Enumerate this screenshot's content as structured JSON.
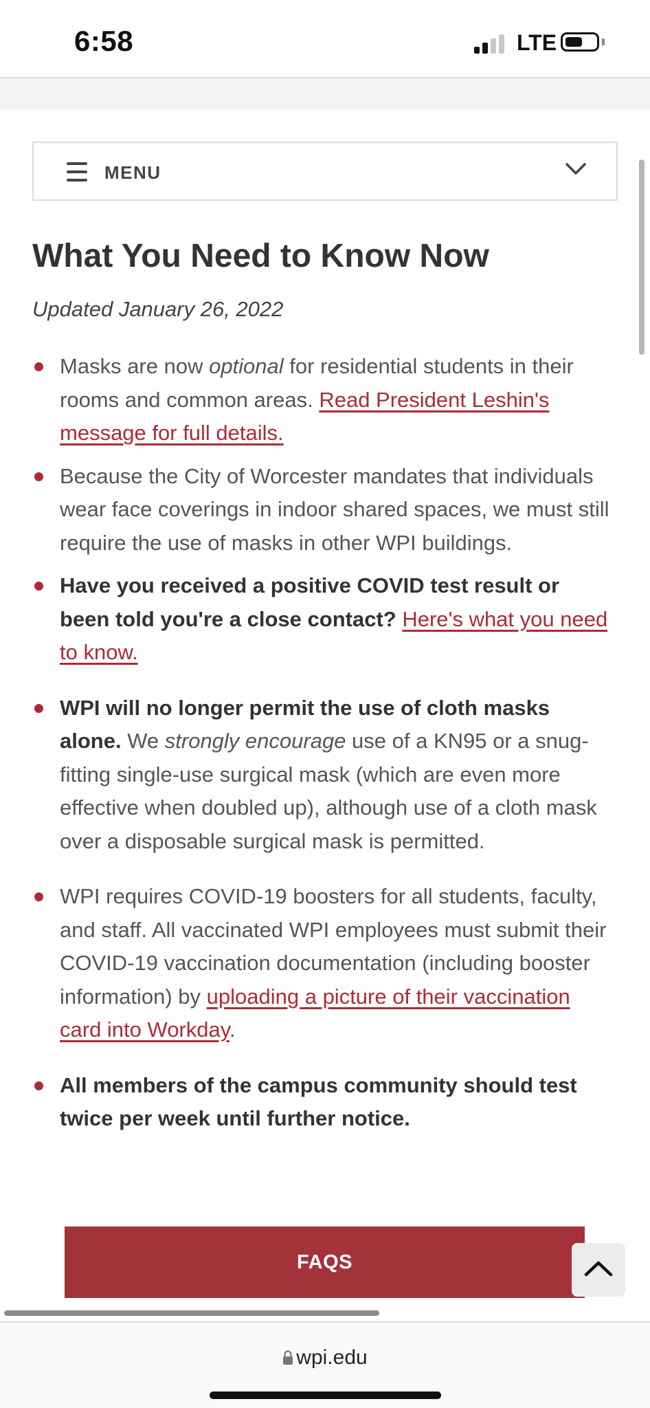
{
  "status_bar": {
    "time": "6:58",
    "network": "LTE",
    "signal_bars_filled": 2,
    "signal_bars_total": 4
  },
  "menu": {
    "label": "MENU",
    "hamburger_icon": "hamburger-icon",
    "expand_icon": "chevron-down-icon"
  },
  "page": {
    "title": "What You Need to Know Now",
    "updated": "Updated January 26, 2022"
  },
  "bullets": [
    {
      "t1": "Masks are now ",
      "em": "optional",
      "t2": " for residential students in their rooms and common areas. ",
      "link": "Read President Leshin's message for full details."
    },
    {
      "text": "Because the City of Worcester mandates that individuals wear face coverings in indoor shared spaces, we must still require the use of masks in other WPI buildings."
    },
    {
      "bold": "Have you received a positive COVID test result or been told you're a close contact?",
      "link": "Here's what you need to know."
    },
    {
      "bold": "WPI will no longer permit the use of cloth masks alone.",
      "t1": " We ",
      "em": "strongly encourage",
      "t2": " use of a KN95 or a snug-fitting single-use surgical mask (which are even more effective when doubled up), although use of a cloth mask over a disposable surgical mask is permitted."
    },
    {
      "t1": "WPI requires COVID-19 boosters for all students, faculty, and staff. All vaccinated WPI employees must submit their COVID-19 vaccination documentation (including booster information) by ",
      "link": "uploading a picture of their vaccination card into Workday",
      "t2": "."
    },
    {
      "bold": "All members of the campus community should test twice per week until further notice."
    }
  ],
  "faqs_button": {
    "label": "FAQS"
  },
  "back_to_top": {
    "icon": "chevron-up-icon"
  },
  "browser": {
    "url": "wpi.edu",
    "lock_icon": "lock-icon"
  },
  "colors": {
    "accent": "#ac2b37",
    "button": "#a3323b"
  }
}
